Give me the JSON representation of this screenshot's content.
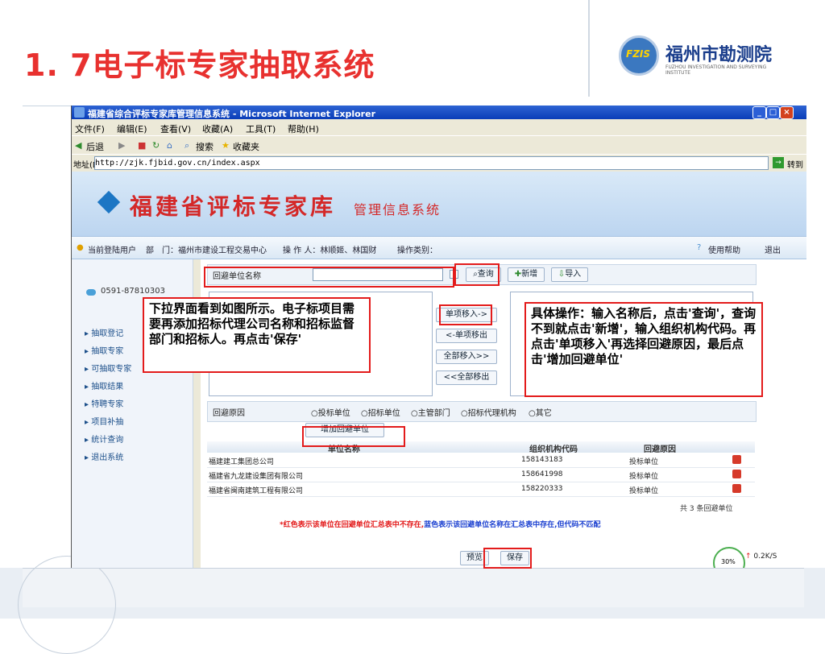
{
  "slide": {
    "title": "1. 7电子标专家抽取系统",
    "logo_mark": "FZIS",
    "logo_name": "福州市勘测院",
    "logo_en": "FUZHOU INVESTIGATION AND SURVEYING INSTITUTE"
  },
  "window": {
    "title": "福建省综合评标专家库管理信息系统 - Microsoft Internet Explorer",
    "menu": [
      "文件(F)",
      "编辑(E)",
      "查看(V)",
      "收藏(A)",
      "工具(T)",
      "帮助(H)"
    ],
    "toolbar": {
      "back": "后退",
      "search": "搜索",
      "favorites": "收藏夹"
    },
    "address_label": "地址(D)",
    "address_url": "http://zjk.fjbid.gov.cn/index.aspx",
    "go_label": "转到"
  },
  "banner": {
    "title": "福建省评标专家库",
    "subtitle": "管理信息系统"
  },
  "infobar": {
    "user": "当前登陆用户",
    "dept": "部　门：福州市建设工程交易中心",
    "operator": "操 作 人：林顺姬、林国财",
    "op_type": "操作类别：",
    "help": "使用帮助",
    "logout": "退出"
  },
  "sidebar": {
    "phone": "0591-87810303",
    "items": [
      "抽取登记",
      "抽取专家",
      "可抽取专家",
      "抽取结果",
      "特聘专家",
      "项目补抽",
      "统计查询",
      "退出系统"
    ]
  },
  "form": {
    "unit_label": "回避单位名称",
    "query_btn": "查询",
    "new_btn": "新增",
    "import_btn": "导入",
    "move_in_one": "单项移入->",
    "move_out_one": "<-单项移出",
    "move_in_all": "全部移入>>",
    "move_out_all": "<<全部移出",
    "reason_label": "回避原因",
    "reasons": [
      "投标单位",
      "招标单位",
      "主管部门",
      "招标代理机构",
      "其它"
    ],
    "add_btn": "增加回避单位"
  },
  "table": {
    "headers": [
      "单位名称",
      "组织机构代码",
      "回避原因"
    ],
    "rows": [
      [
        "福建建工集团总公司",
        "158143183",
        "投标单位"
      ],
      [
        "福建省九龙建设集团有限公司",
        "158641998",
        "投标单位"
      ],
      [
        "福建省闽南建筑工程有限公司",
        "158220333",
        "投标单位"
      ]
    ],
    "count": "共 3 条回避单位",
    "legend_red": "*红色表示该单位在回避单位汇总表中不存在,",
    "legend_blue": "蓝色表示该回避单位名称在汇总表中存在,但代码不匹配"
  },
  "bottom": {
    "preview": "预览",
    "save": "保存",
    "net_speed": "0.2K/S",
    "net_pct": "30%"
  },
  "notes": {
    "left": "下拉界面看到如图所示。电子标项目需要再添加招标代理公司名称和招标监督部门和招标人。再点击'保存'",
    "right": "具体操作：输入名称后，点击'查询'，查询不到就点击'新增'，输入组织机构代码。再点击'单项移入'再选择回避原因，最后点击'增加回避单位'"
  },
  "colors": {
    "accent": "#e8312f",
    "highlight": "#e31b1b",
    "xp_blue": "#0a3db8",
    "legend_blue": "#1a3fd0"
  }
}
